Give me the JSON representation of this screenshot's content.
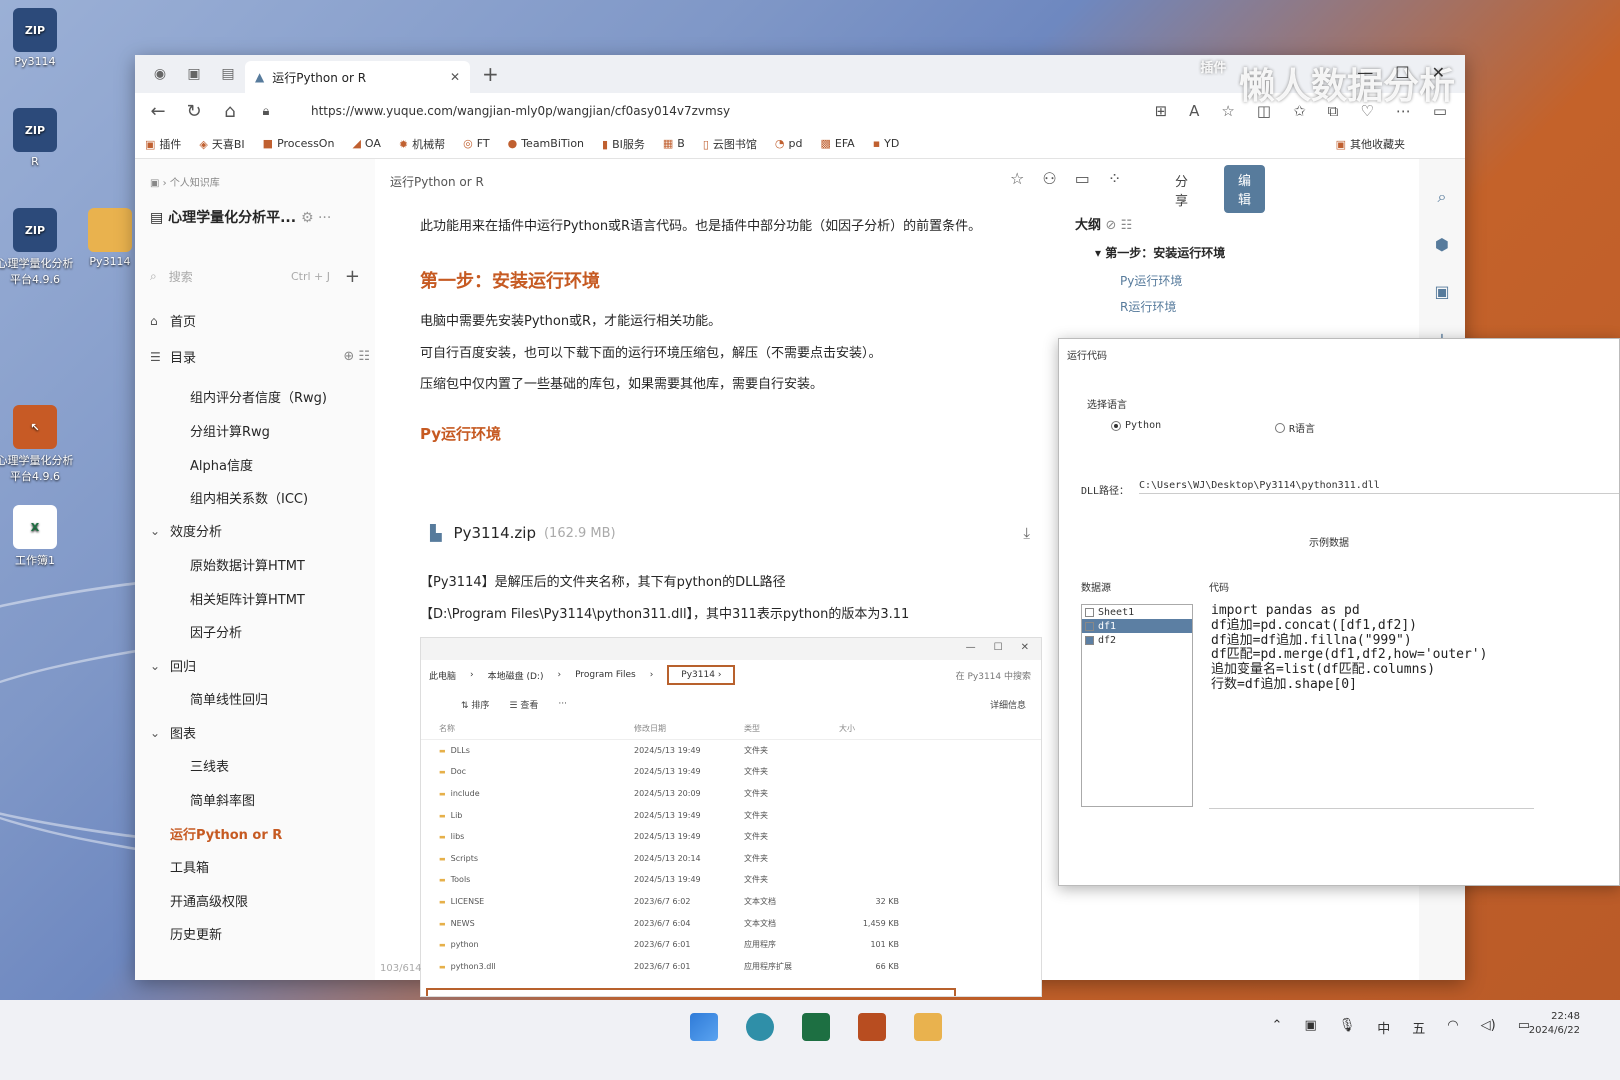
{
  "desktop": {
    "icons": [
      {
        "label": "Py3114",
        "type": "zip"
      },
      {
        "label": "R",
        "type": "zip"
      },
      {
        "label": "心理学量化分析平台4.9.6",
        "type": "zip"
      },
      {
        "label": "Py3114",
        "type": "folder"
      },
      {
        "label": "心理学量化分析平台4.9.6",
        "type": "app"
      },
      {
        "label": "工作簿1",
        "type": "excel"
      }
    ]
  },
  "browser": {
    "tab_title": "运行Python or R",
    "url": "https://www.yuque.com/wangjian-mly0p/wangjian/cf0asy014v7zvmsy",
    "watermark": "懒人数据分析",
    "watermark_small": "插件",
    "bookmarks": [
      "插件",
      "天喜BI",
      "ProcessOn",
      "OA",
      "机械帮",
      "FT",
      "TeamBiTion",
      "BI服务",
      "B",
      "云图书馆",
      "pd",
      "EFA",
      "YD"
    ],
    "other_bookmarks": "其他收藏夹"
  },
  "sidebar": {
    "breadcrumb": "个人知识库",
    "kb_title": "心理学量化分析平...",
    "search_placeholder": "搜索",
    "search_shortcut": "Ctrl + J",
    "home": "首页",
    "toc": "目录",
    "items": [
      {
        "label": "组内评分者信度（Rwg)",
        "level": 2
      },
      {
        "label": "分组计算Rwg",
        "level": 2
      },
      {
        "label": "Alpha信度",
        "level": 2
      },
      {
        "label": "组内相关系数（ICC)",
        "level": 2
      },
      {
        "label": "效度分析",
        "level": 1
      },
      {
        "label": "原始数据计算HTMT",
        "level": 2
      },
      {
        "label": "相关矩阵计算HTMT",
        "level": 2
      },
      {
        "label": "因子分析",
        "level": 2
      },
      {
        "label": "回归",
        "level": 1
      },
      {
        "label": "简单线性回归",
        "level": 2
      },
      {
        "label": "图表",
        "level": 1
      },
      {
        "label": "三线表",
        "level": 2
      },
      {
        "label": "简单斜率图",
        "level": 2
      },
      {
        "label": "运行Python or R",
        "level": 0,
        "active": true
      },
      {
        "label": "工具箱",
        "level": 0
      },
      {
        "label": "开通高级权限",
        "level": 0
      },
      {
        "label": "历史更新",
        "level": 0
      }
    ],
    "page_count": "103/614"
  },
  "doc": {
    "title": "运行Python or R",
    "share": "分享",
    "edit": "编辑",
    "intro": "此功能用来在插件中运行Python或R语言代码。也是插件中部分功能（如因子分析）的前置条件。",
    "step1": "第一步：安装运行环境",
    "p1": "电脑中需要先安装Python或R，才能运行相关功能。",
    "p2": "可自行百度安装，也可以下载下面的运行环境压缩包，解压（不需要点击安装）。",
    "p3": "压缩包中仅内置了一些基础的库包，如果需要其他库，需要自行安装。",
    "py_env": "Py运行环境",
    "file_name": "Py3114.zip",
    "file_size": "(162.9 MB)",
    "p4": "【Py3114】是解压后的文件夹名称，其下有python的DLL路径",
    "p5": "【D:\\Program Files\\Py3114\\python311.dll】，其中311表示python的版本为3.11"
  },
  "explorer": {
    "path": [
      "此电脑",
      "本地磁盘 (D:)",
      "Program Files",
      "Py3114"
    ],
    "search": "在 Py3114 中搜索",
    "sort": "排序",
    "view": "查看",
    "details": "详细信息",
    "columns": [
      "名称",
      "修改日期",
      "类型",
      "大小"
    ],
    "rows": [
      [
        "DLLs",
        "2024/5/13 19:49",
        "文件夹",
        ""
      ],
      [
        "Doc",
        "2024/5/13 19:49",
        "文件夹",
        ""
      ],
      [
        "include",
        "2024/5/13 20:09",
        "文件夹",
        ""
      ],
      [
        "Lib",
        "2024/5/13 19:49",
        "文件夹",
        ""
      ],
      [
        "libs",
        "2024/5/13 19:49",
        "文件夹",
        ""
      ],
      [
        "Scripts",
        "2024/5/13 20:14",
        "文件夹",
        ""
      ],
      [
        "Tools",
        "2024/5/13 19:49",
        "文件夹",
        ""
      ],
      [
        "LICENSE",
        "2023/6/7 6:02",
        "文本文档",
        "32 KB"
      ],
      [
        "NEWS",
        "2023/6/7 6:04",
        "文本文档",
        "1,459 KB"
      ],
      [
        "python",
        "2023/6/7 6:01",
        "应用程序",
        "101 KB"
      ],
      [
        "python3.dll",
        "2023/6/7 6:01",
        "应用程序扩展",
        "66 KB"
      ]
    ]
  },
  "outline": {
    "title": "大纲",
    "h1": "第一步：安装运行环境",
    "h2a": "Py运行环境",
    "h2b": "R运行环境"
  },
  "dialog": {
    "title": "运行代码",
    "choose_lang": "选择语言",
    "opt_python": "Python",
    "opt_r": "R语言",
    "dll_label": "DLL路径：",
    "dll_path": "C:\\Users\\WJ\\Desktop\\Py3114\\python311.dll",
    "example": "示例数据",
    "datasource": "数据源",
    "code_label": "代码",
    "sheets": [
      "Sheet1",
      "df1",
      "df2"
    ],
    "code": "import pandas as pd\ndf追加=pd.concat([df1,df2])\ndf追加=df追加.fillna(\"999\")\ndf匹配=pd.merge(df1,df2,how='outer')\n追加变量名=list(df匹配.columns)\n行数=df追加.shape[0]"
  },
  "taskbar": {
    "time": "22:48",
    "date": "2024/6/22",
    "ime": "中",
    "ime2": "五"
  }
}
